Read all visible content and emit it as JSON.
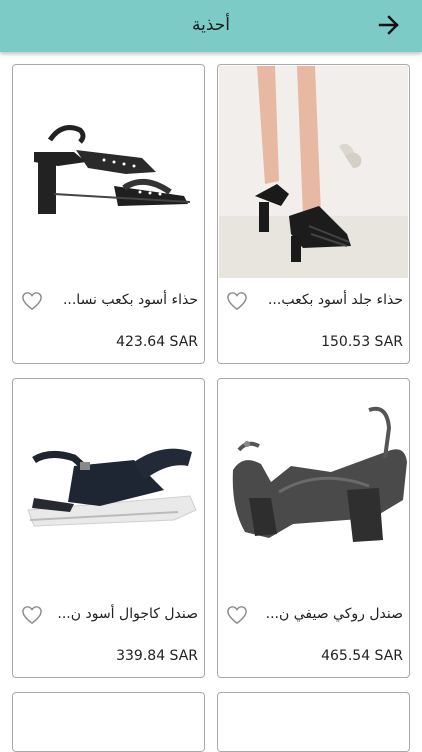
{
  "header": {
    "title": "أحذية",
    "back_icon": "arrow-right-icon"
  },
  "products": [
    {
      "name": "حذاء جلد أسود بكعب...",
      "price": "150.53 SAR"
    },
    {
      "name": "حذاء أسود بكعب نسا...",
      "price": "423.64 SAR"
    },
    {
      "name": "صندل روكي صيفي ن...",
      "price": "465.54 SAR"
    },
    {
      "name": "صندل كاجوال أسود ن...",
      "price": "339.84 SAR"
    }
  ],
  "colors": {
    "appbar": "#7ccbc7",
    "card_border": "#a9a9a9"
  }
}
